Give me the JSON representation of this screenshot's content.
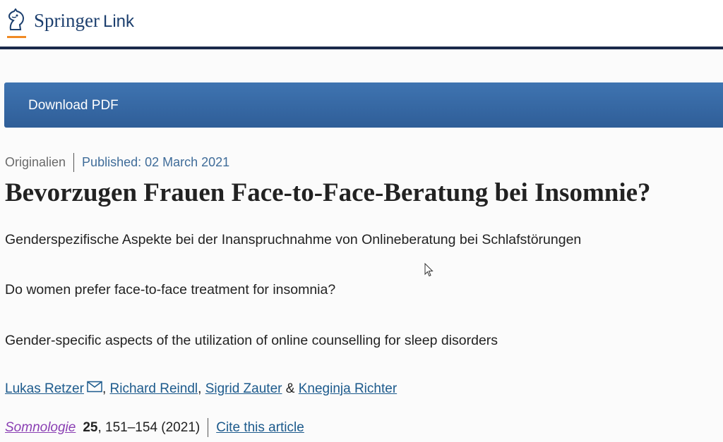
{
  "header": {
    "brand": "Springer",
    "brand_suffix": "Link"
  },
  "download": {
    "label": "Download PDF"
  },
  "article": {
    "type": "Originalien",
    "published": "Published: 02 March 2021",
    "title": "Bevorzugen Frauen Face-to-Face-Beratung bei Insomnie?",
    "subtitle_de": "Genderspezifische Aspekte bei der Inanspruchnahme von Onlineberatung bei Schlafstörungen",
    "title_en": "Do women prefer face-to-face treatment for insomnia?",
    "subtitle_en": "Gender-specific aspects of the utilization of online counselling for sleep disorders"
  },
  "authors": {
    "a1": "Lukas Retzer",
    "sep1": ",",
    "a2": "Richard Reindl",
    "sep2": ",",
    "a3": "Sigrid Zauter",
    "sep3": "&",
    "a4": "Kneginja Richter"
  },
  "journal": {
    "name": "Somnologie",
    "volume": "25",
    "pages": ", 151–154 (2021)",
    "cite_label": "Cite this article"
  },
  "colors": {
    "brand_blue": "#1c3f6e",
    "accent_orange": "#f08a24",
    "download_bar": "#3567a4",
    "link_blue": "#1c5a8c",
    "journal_purple": "#8a3fb3"
  },
  "icons": {
    "logo": "horse-head-logo-icon",
    "mail": "envelope-icon",
    "cursor": "mouse-pointer-icon"
  }
}
